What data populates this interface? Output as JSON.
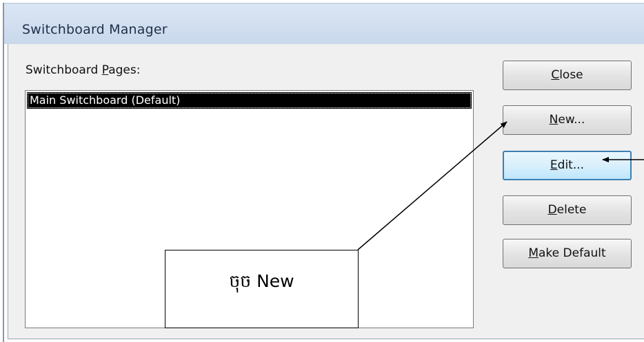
{
  "window": {
    "title": "Switchboard Manager"
  },
  "pages_label": {
    "prefix": "Switchboard ",
    "access_key": "P",
    "suffix": "ages:"
  },
  "pages_list": {
    "items": [
      {
        "label": "Main Switchboard (Default)",
        "selected": true
      }
    ]
  },
  "buttons": {
    "close": {
      "access_key": "C",
      "rest": "lose"
    },
    "new": {
      "access_key": "N",
      "rest": "ew..."
    },
    "edit": {
      "access_key": "E",
      "rest": "dit..."
    },
    "delete": {
      "access_key": "D",
      "rest": "elete"
    },
    "make_default": {
      "access_key": "M",
      "rest": "ake Default"
    }
  },
  "annotation": {
    "callout_text": "ចុច New",
    "arrow_color": "#000000"
  },
  "colors": {
    "titlebar": "#dbe6f4",
    "dialog_background": "#f0f0f0",
    "selection_background": "#000000",
    "selection_text": "#ffffff",
    "focus_border": "#3c7fb1"
  }
}
